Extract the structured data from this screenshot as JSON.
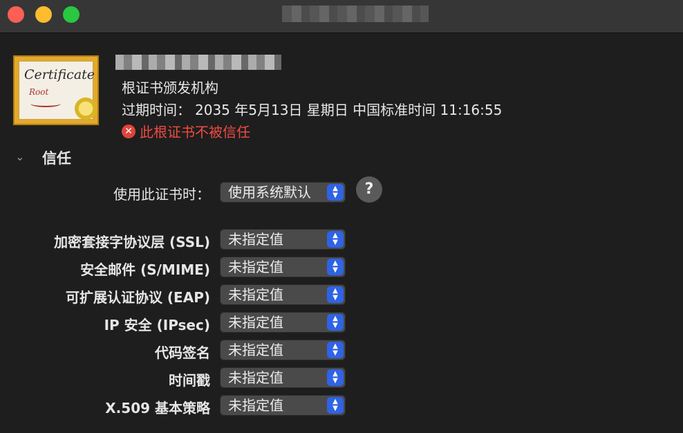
{
  "window": {
    "controls": [
      "close",
      "minimize",
      "zoom"
    ]
  },
  "certificate": {
    "icon_text": "Certificate",
    "icon_subtext": "Root",
    "issuer_line": "根证书颁发机构",
    "expiry_label": "过期时间：",
    "expiry_value": "2035 年5月13日 星期日 中国标准时间 11:16:55",
    "status_text": "此根证书不被信任",
    "status_icon": "error-x-icon",
    "status_color": "#ef4b43"
  },
  "trust": {
    "section_title": "信任",
    "when_using_label": "使用此证书时：",
    "when_using_value": "使用系统默认",
    "help_label": "?",
    "rows": [
      {
        "label": "加密套接字协议层 (SSL)",
        "value": "未指定值"
      },
      {
        "label": "安全邮件 (S/MIME)",
        "value": "未指定值"
      },
      {
        "label": "可扩展认证协议 (EAP)",
        "value": "未指定值"
      },
      {
        "label": "IP 安全 (IPsec)",
        "value": "未指定值"
      },
      {
        "label": "代码签名",
        "value": "未指定值"
      },
      {
        "label": "时间戳",
        "value": "未指定值"
      },
      {
        "label": "X.509 基本策略",
        "value": "未指定值"
      }
    ]
  },
  "colors": {
    "accent": "#2f63e6",
    "close": "#fe5f57",
    "minimize": "#febc2e",
    "zoom": "#28c840"
  }
}
